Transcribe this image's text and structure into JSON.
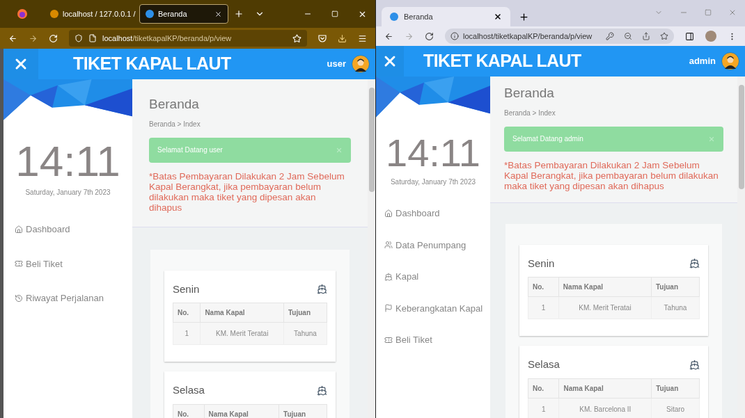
{
  "windows": [
    {
      "kind": "firefox",
      "tabs": [
        {
          "title": "localhost / 127.0.0.1 /",
          "selected": false
        },
        {
          "title": "Beranda",
          "selected": true
        }
      ],
      "url": {
        "host": "localhost",
        "path": "/tiketkapalKP/beranda/p/view"
      },
      "app": {
        "title": "TIKET KAPAL LAUT",
        "user": "user",
        "clock": "14:11",
        "date": "Saturday, January 7th 2023",
        "nav": [
          {
            "label": "Dashboard",
            "kind": "home"
          },
          {
            "label": "Beli Tiket",
            "kind": "ticket"
          },
          {
            "label": "Riwayat Perjalanan",
            "kind": "history"
          }
        ],
        "page_title": "Beranda",
        "breadcrumb": "Beranda > Index",
        "alert": "Selamat Datang user",
        "notice": "*Batas Pembayaran Dilakukan 2 Jam Sebelum Kapal Berangkat, jika pembayaran belum dilakukan maka tiket yang dipesan akan dihapus",
        "schedules": [
          {
            "day": "Senin",
            "columns": [
              "No.",
              "Nama Kapal",
              "Tujuan"
            ],
            "rows": [
              [
                "1",
                "KM. Merit Teratai",
                "Tahuna"
              ]
            ]
          },
          {
            "day": "Selasa",
            "columns": [
              "No.",
              "Nama Kapal",
              "Tujuan"
            ]
          }
        ]
      }
    },
    {
      "kind": "chrome",
      "tabs": [
        {
          "title": "Beranda",
          "selected": true
        }
      ],
      "url": {
        "host": "localhost",
        "path": "/tiketkapalKP/beranda/p/view"
      },
      "app": {
        "title": "TIKET KAPAL LAUT",
        "user": "admin",
        "clock": "14:11",
        "date": "Saturday, January 7th 2023",
        "nav": [
          {
            "label": "Dashboard",
            "kind": "home"
          },
          {
            "label": "Data Penumpang",
            "kind": "users"
          },
          {
            "label": "Kapal",
            "kind": "ship"
          },
          {
            "label": "Keberangkatan Kapal",
            "kind": "flag"
          },
          {
            "label": "Beli Tiket",
            "kind": "ticket"
          }
        ],
        "page_title": "Beranda",
        "breadcrumb": "Beranda > Index",
        "alert": "Selamat Datang admin",
        "notice": "*Batas Pembayaran Dilakukan 2 Jam Sebelum Kapal Berangkat, jika pembayaran belum dilakukan maka tiket yang dipesan akan dihapus",
        "schedules": [
          {
            "day": "Senin",
            "columns": [
              "No.",
              "Nama Kapal",
              "Tujuan"
            ],
            "rows": [
              [
                "1",
                "KM. Merit Teratai",
                "Tahuna"
              ]
            ]
          },
          {
            "day": "Selasa",
            "columns": [
              "No.",
              "Nama Kapal",
              "Tujuan"
            ],
            "rows": [
              [
                "1",
                "KM. Barcelona II",
                "Sitaro"
              ]
            ]
          }
        ]
      }
    }
  ]
}
